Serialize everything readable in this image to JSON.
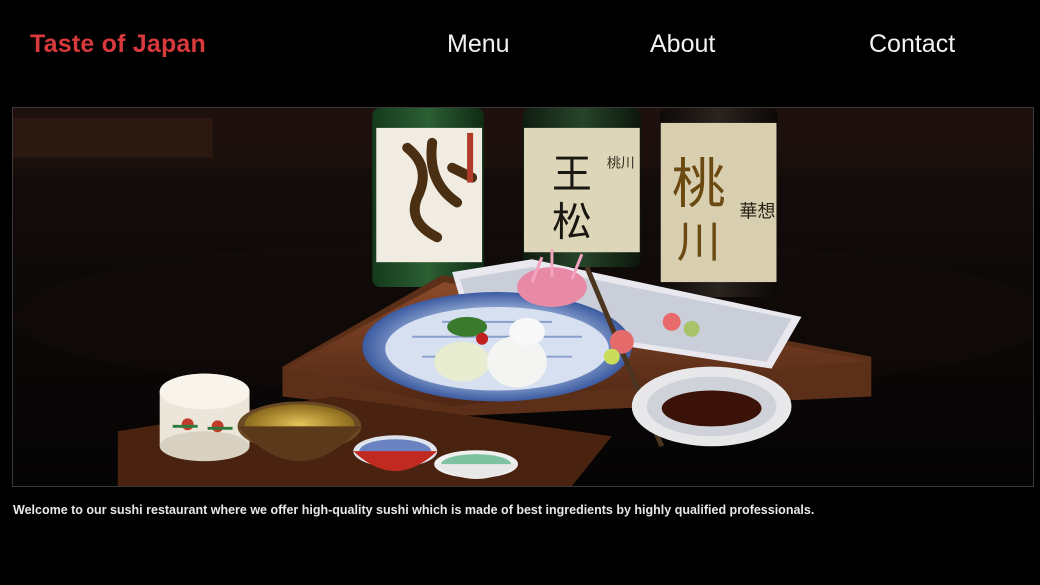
{
  "header": {
    "brand": "Taste of Japan",
    "nav": [
      {
        "label": "Menu"
      },
      {
        "label": "About"
      },
      {
        "label": "Contact"
      }
    ]
  },
  "hero": {
    "image_description": "sake bottles and sushi tray"
  },
  "main": {
    "intro_text": "Welcome to our sushi restaurant where we offer high-quality sushi which is made of best ingredients by highly qualified professionals."
  },
  "colors": {
    "background": "#000000",
    "brand": "#d8393d",
    "nav_text": "#f2f2f2"
  }
}
